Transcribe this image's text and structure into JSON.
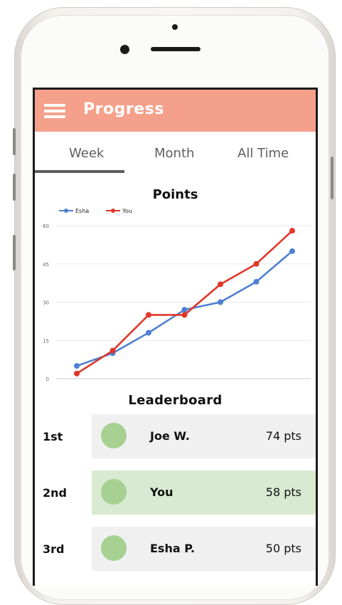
{
  "colors": {
    "header": "#f5a08a",
    "esha": "#4f80d1",
    "you": "#e0372a",
    "avatar": "#a6d192",
    "highlight_row": "#d8ebd2"
  },
  "header": {
    "title": "Progress",
    "menu_icon": "hamburger-icon"
  },
  "tabs": [
    {
      "label": "Week",
      "active": true
    },
    {
      "label": "Month",
      "active": false
    },
    {
      "label": "All Time",
      "active": false
    }
  ],
  "chart_data": {
    "type": "line",
    "title": "Points",
    "x": [
      1,
      2,
      3,
      4,
      5,
      6,
      7
    ],
    "series": [
      {
        "name": "Esha",
        "color": "#4f80d1",
        "values": [
          5,
          10,
          18,
          27,
          30,
          38,
          50
        ]
      },
      {
        "name": "You",
        "color": "#e0372a",
        "values": [
          2,
          11,
          25,
          25,
          37,
          45,
          58
        ]
      }
    ],
    "yticks": [
      "0",
      "15",
      "30",
      "45",
      "60"
    ],
    "ylim": [
      0,
      60
    ],
    "grid": true,
    "legend": "top-left",
    "xlabel": "",
    "ylabel": ""
  },
  "leaderboard": {
    "title": "Leaderboard",
    "rows": [
      {
        "rank": "1st",
        "name": "Joe W.",
        "points": "74 pts",
        "highlight": false
      },
      {
        "rank": "2nd",
        "name": "You",
        "points": "58 pts",
        "highlight": true
      },
      {
        "rank": "3rd",
        "name": "Esha P.",
        "points": "50 pts",
        "highlight": false
      }
    ]
  }
}
